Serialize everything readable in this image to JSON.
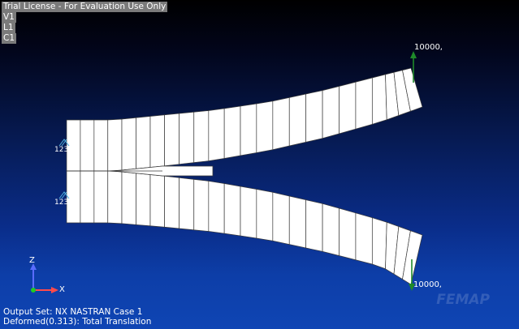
{
  "overlay": {
    "license_text": "Trial License - For Evaluation Use Only",
    "view_tag": "V1",
    "layer_tag": "L1",
    "color_tag": "C1"
  },
  "status": {
    "output_set": "Output Set: NX NASTRAN Case 1",
    "deformed": "Deformed(0.313): Total Translation"
  },
  "loads": {
    "top_force_label": "10000,",
    "bottom_force_label": "10000,"
  },
  "constraints": {
    "top_label": "123",
    "bottom_label": "123"
  },
  "triad": {
    "z_label": "Z",
    "x_label": "X"
  },
  "watermark": "FEMAP",
  "colors": {
    "mesh_fill": "#ffffff",
    "mesh_line": "#3a3a3a",
    "force_arrow": "#1f8a2a",
    "constraint": "#4fb0e0",
    "triad_z": "#5a6cff",
    "triad_x": "#ff4a4a",
    "triad_origin": "#22cc22"
  }
}
